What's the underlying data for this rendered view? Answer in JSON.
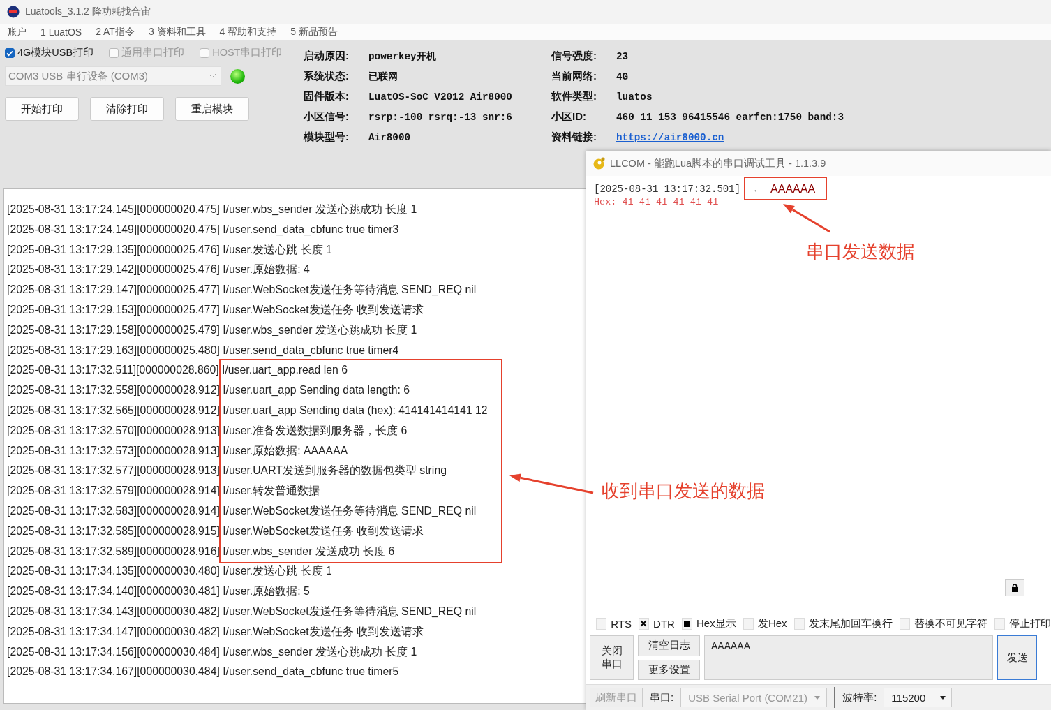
{
  "window": {
    "title": "Luatools_3.1.2 降功耗找合宙"
  },
  "menu": [
    "账户",
    "1 LuatOS",
    "2 AT指令",
    "3 资料和工具",
    "4 帮助和支持",
    "5 新品预告"
  ],
  "print_options": [
    {
      "label": "4G模块USB打印",
      "checked": true
    },
    {
      "label": "通用串口打印",
      "checked": false
    },
    {
      "label": "HOST串口打印",
      "checked": false
    }
  ],
  "port": {
    "value": "COM3 USB 串行设备 (COM3)",
    "connected": true
  },
  "buttons": [
    "开始打印",
    "清除打印",
    "重启模块"
  ],
  "info_left": [
    {
      "label": "启动原因:",
      "value": "powerkey开机"
    },
    {
      "label": "系统状态:",
      "value": "已联网"
    },
    {
      "label": "固件版本:",
      "value": "LuatOS-SoC_V2012_Air8000"
    },
    {
      "label": "小区信号:",
      "value": "rsrp:-100 rsrq:-13 snr:6"
    },
    {
      "label": "模块型号:",
      "value": "Air8000"
    }
  ],
  "info_right": [
    {
      "label": "信号强度:",
      "value": "23",
      "kind": "text"
    },
    {
      "label": "当前网络:",
      "value": "4G",
      "kind": "text"
    },
    {
      "label": "软件类型:",
      "value": "luatos",
      "kind": "text"
    },
    {
      "label": "小区ID:",
      "value": "460 11 153 96415546 earfcn:1750 band:3",
      "kind": "text"
    },
    {
      "label": "资料链接:",
      "value": "https://air8000.cn",
      "kind": "link"
    }
  ],
  "log": [
    "[2025-08-31 13:17:24.145][000000020.475] I/user.wbs_sender 发送心跳成功 长度 1",
    "[2025-08-31 13:17:24.149][000000020.475] I/user.send_data_cbfunc true timer3",
    "[2025-08-31 13:17:29.135][000000025.476] I/user.发送心跳 长度 1",
    "[2025-08-31 13:17:29.142][000000025.476] I/user.原始数据: 4",
    "[2025-08-31 13:17:29.147][000000025.477] I/user.WebSocket发送任务等待消息 SEND_REQ nil",
    "[2025-08-31 13:17:29.153][000000025.477] I/user.WebSocket发送任务 收到发送请求",
    "[2025-08-31 13:17:29.158][000000025.479] I/user.wbs_sender 发送心跳成功 长度 1",
    "[2025-08-31 13:17:29.163][000000025.480] I/user.send_data_cbfunc true timer4",
    "[2025-08-31 13:17:32.511][000000028.860] I/user.uart_app.read len 6",
    "[2025-08-31 13:17:32.558][000000028.912] I/user.uart_app Sending data length: 6",
    "[2025-08-31 13:17:32.565][000000028.912] I/user.uart_app Sending data (hex): 414141414141 12",
    "[2025-08-31 13:17:32.570][000000028.913] I/user.准备发送数据到服务器，长度 6",
    "[2025-08-31 13:17:32.573][000000028.913] I/user.原始数据: AAAAAA",
    "[2025-08-31 13:17:32.577][000000028.913] I/user.UART发送到服务器的数据包类型 string",
    "[2025-08-31 13:17:32.579][000000028.914] I/user.转发普通数据",
    "[2025-08-31 13:17:32.583][000000028.914] I/user.WebSocket发送任务等待消息 SEND_REQ nil",
    "[2025-08-31 13:17:32.585][000000028.915] I/user.WebSocket发送任务 收到发送请求",
    "[2025-08-31 13:17:32.589][000000028.916] I/user.wbs_sender 发送成功 长度 6",
    "[2025-08-31 13:17:34.135][000000030.480] I/user.发送心跳 长度 1",
    "[2025-08-31 13:17:34.140][000000030.481] I/user.原始数据: 5",
    "[2025-08-31 13:17:34.143][000000030.482] I/user.WebSocket发送任务等待消息 SEND_REQ nil",
    "[2025-08-31 13:17:34.147][000000030.482] I/user.WebSocket发送任务 收到发送请求",
    "[2025-08-31 13:17:34.156][000000030.484] I/user.wbs_sender 发送心跳成功 长度 1",
    "[2025-08-31 13:17:34.167][000000030.484] I/user.send_data_cbfunc true timer5"
  ],
  "llcom": {
    "title": "LLCOM - 能跑Lua脚本的串口调试工具 - 1.1.3.9",
    "entries": [
      {
        "time": "[2025-08-31 13:17:32.501]",
        "direction": "←",
        "data": "AAAAAA",
        "hex": "Hex: 41 41 41 41 41 41"
      }
    ],
    "options": [
      {
        "label": "RTS",
        "checked": false,
        "kind": "cross"
      },
      {
        "label": "DTR",
        "checked": true,
        "kind": "cross"
      },
      {
        "label": "Hex显示",
        "checked": true,
        "kind": "square"
      },
      {
        "label": "发Hex",
        "checked": false,
        "kind": "cross"
      },
      {
        "label": "发末尾加回车换行",
        "checked": false,
        "kind": "cross"
      },
      {
        "label": "替换不可见字符",
        "checked": false,
        "kind": "cross"
      },
      {
        "label": "停止打印",
        "checked": false,
        "kind": "cross"
      }
    ],
    "close_button": "关闭串口",
    "clear_button": "清空日志",
    "settings_button": "更多设置",
    "send_text": "AAAAAA",
    "send_button": "发送",
    "refresh_button": "刷新串口",
    "port_label": "串口:",
    "port_value": "USB Serial Port (COM21)",
    "baud_label": "波特率:",
    "baud_value": "115200"
  },
  "annotations": [
    {
      "text": "串口发送数据"
    },
    {
      "text": "收到串口发送的数据"
    }
  ]
}
